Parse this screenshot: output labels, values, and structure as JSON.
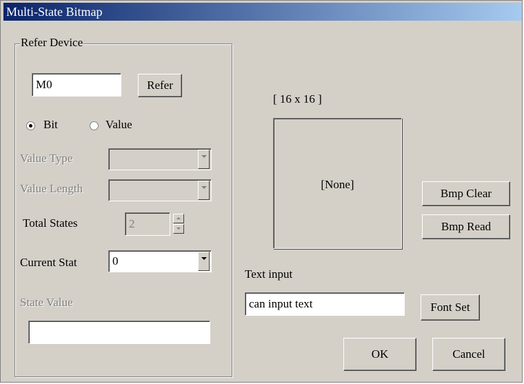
{
  "window": {
    "title": "Multi-State Bitmap"
  },
  "refer_device": {
    "group_label": "Refer Device",
    "device_value": "M0",
    "refer_button": "Refer",
    "radio_bit": "Bit",
    "radio_value": "Value",
    "selected": "Bit",
    "value_type_label": "Value Type",
    "value_type_value": "",
    "value_length_label": "Value Length",
    "value_length_value": "",
    "total_states_label": "Total States",
    "total_states_value": "2",
    "current_stat_label": "Current Stat",
    "current_stat_value": "0",
    "state_value_label": "State Value",
    "state_value_value": ""
  },
  "bitmap": {
    "size_label": "[ 16 x 16 ]",
    "preview_text": "[None]",
    "bmp_clear_button": "Bmp Clear",
    "bmp_read_button": "Bmp Read"
  },
  "text": {
    "label": "Text input",
    "value": "can input text",
    "font_set_button": "Font Set"
  },
  "footer": {
    "ok_button": "OK",
    "cancel_button": "Cancel"
  },
  "colors": {
    "face": "#d4d0c8",
    "title_start": "#0a246a",
    "title_end": "#a6caf0",
    "disabled_text": "#808080"
  }
}
